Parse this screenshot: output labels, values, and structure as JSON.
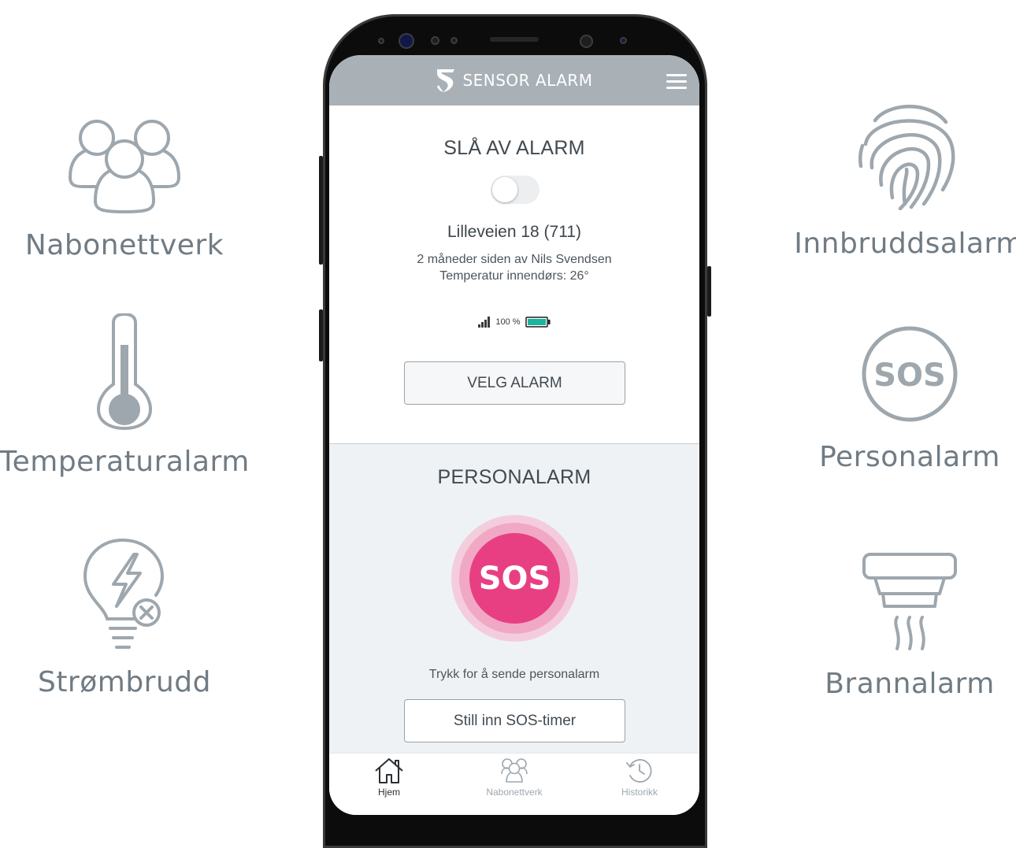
{
  "features": {
    "nabonettverk": "Nabonettverk",
    "temperaturalarm": "Temperaturalarm",
    "strombrudd": "Strømbrudd",
    "innbruddsalarm": "Innbruddsalarm",
    "personalarm": "Personalarm",
    "brannalarm": "Brannalarm",
    "sos_badge": "SOS"
  },
  "colors": {
    "icon_gray": "#9ea7ae",
    "header_bg": "#a9b1b7",
    "sos_pink": "#e83f83",
    "battery_teal": "#1ab59c"
  },
  "app": {
    "brand": "SENSOR ALARM",
    "alarm_section": {
      "title": "SLÅ AV ALARM",
      "toggle_on": false,
      "address": "Lilleveien 18 (711)",
      "last_change": "2 måneder siden av Nils Svendsen",
      "temperature": "Temperatur innendørs: 26°",
      "battery": "100 %",
      "select_button": "VELG ALARM"
    },
    "personal_section": {
      "title": "PERSONALARM",
      "sos_button": "SOS",
      "caption": "Trykk for å sende personalarm",
      "timer_button": "Still inn SOS-timer"
    },
    "tabs": [
      {
        "label": "Hjem",
        "icon": "home-icon",
        "active": true
      },
      {
        "label": "Nabonettverk",
        "icon": "users-icon",
        "active": false
      },
      {
        "label": "Historikk",
        "icon": "history-icon",
        "active": false
      }
    ]
  }
}
